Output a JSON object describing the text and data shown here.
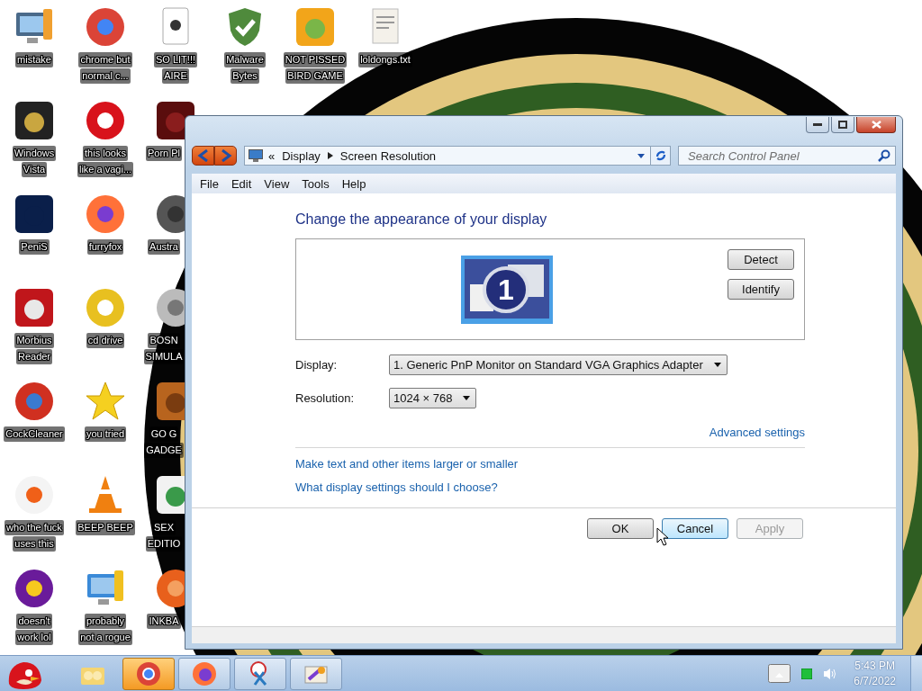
{
  "desktop": {
    "icons": [
      {
        "label_lines": [
          "mistake"
        ]
      },
      {
        "label_lines": [
          "chrome but",
          "normal c..."
        ]
      },
      {
        "label_lines": [
          "SO LIT!!!",
          "AIRE"
        ]
      },
      {
        "label_lines": [
          "Malware",
          "Bytes"
        ]
      },
      {
        "label_lines": [
          "NOT PISSED",
          "BIRD GAME"
        ]
      },
      {
        "label_lines": [
          "loldongs.txt"
        ]
      },
      {
        "label_lines": [
          "Windows",
          "Vista"
        ]
      },
      {
        "label_lines": [
          "this looks",
          "like a vagi..."
        ]
      },
      {
        "label_lines": [
          "Porn Pl"
        ]
      },
      {
        "label_lines": [
          "PeniS"
        ]
      },
      {
        "label_lines": [
          "furryfox"
        ]
      },
      {
        "label_lines": [
          "Austra"
        ]
      },
      {
        "label_lines": [
          "Morbius",
          "Reader"
        ]
      },
      {
        "label_lines": [
          "cd drive"
        ]
      },
      {
        "label_lines": [
          "BOSN",
          "SIMULA"
        ]
      },
      {
        "label_lines": [
          "CockCleaner"
        ]
      },
      {
        "label_lines": [
          "you tried"
        ]
      },
      {
        "label_lines": [
          "GO G",
          "GADGE"
        ]
      },
      {
        "label_lines": [
          "who the fuck",
          "uses this"
        ]
      },
      {
        "label_lines": [
          "BEEP BEEP"
        ]
      },
      {
        "label_lines": [
          "SEX",
          "EDITIO"
        ]
      },
      {
        "label_lines": [
          "doesn't",
          "work lol"
        ]
      },
      {
        "label_lines": [
          "probably",
          "not a rogue"
        ]
      },
      {
        "label_lines": [
          "INKBA"
        ]
      }
    ]
  },
  "window": {
    "address": {
      "prefix": "«",
      "segments": [
        "Display",
        "Screen Resolution"
      ]
    },
    "search": {
      "placeholder": "Search Control Panel"
    },
    "menu": [
      "File",
      "Edit",
      "View",
      "Tools",
      "Help"
    ],
    "heading": "Change the appearance of your display",
    "monitor": {
      "number": "1"
    },
    "side_buttons": [
      {
        "label": "Detect"
      },
      {
        "label": "Identify"
      }
    ],
    "fields": [
      {
        "label": "Display:",
        "value": "1. Generic PnP Monitor on Standard VGA Graphics Adapter"
      },
      {
        "label": "Resolution:",
        "value": "1024 × 768"
      }
    ],
    "advanced_link": "Advanced settings",
    "links": [
      "Make text and other items larger or smaller",
      "What display settings should I choose?"
    ],
    "buttons": [
      {
        "label": "OK",
        "focused": false,
        "disabled": false
      },
      {
        "label": "Cancel",
        "focused": true,
        "disabled": false
      },
      {
        "label": "Apply",
        "focused": false,
        "disabled": true
      }
    ]
  },
  "taskbar": {
    "items": [
      {
        "running": false,
        "selected": false
      },
      {
        "running": true,
        "selected": true
      },
      {
        "running": true,
        "selected": false
      },
      {
        "running": true,
        "selected": false
      },
      {
        "running": true,
        "selected": false
      }
    ],
    "clock": {
      "time": "5:43 PM",
      "date": "6/7/2022"
    }
  }
}
